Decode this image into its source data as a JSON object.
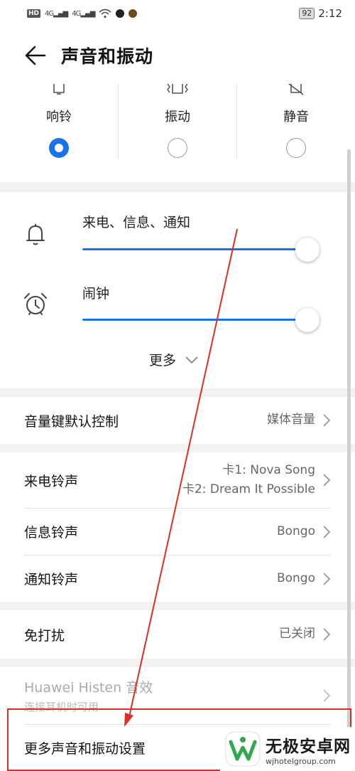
{
  "status_bar": {
    "left_chips": [
      "HD",
      "4G",
      "4G"
    ],
    "battery": "92",
    "time": "2:12"
  },
  "header": {
    "title": "声音和振动",
    "back_icon": "arrow-left-icon"
  },
  "sound_modes": [
    {
      "label": "响铃",
      "icon": "bell-icon",
      "selected": true
    },
    {
      "label": "振动",
      "icon": "vibrate-icon",
      "selected": false
    },
    {
      "label": "静音",
      "icon": "bell-off-icon",
      "selected": false
    }
  ],
  "volumes": [
    {
      "label": "来电、信息、通知",
      "icon": "bell-icon",
      "level": 1.0
    },
    {
      "label": "闹钟",
      "icon": "alarm-clock-icon",
      "level": 1.0
    }
  ],
  "more_label": "更多",
  "settings": {
    "volume_key": {
      "title": "音量键默认控制",
      "value": "媒体音量"
    },
    "ringtone": {
      "title": "来电铃声",
      "value_1": "卡1: Nova Song",
      "value_2": "卡2: Dream It Possible"
    },
    "message_tone": {
      "title": "信息铃声",
      "value": "Bongo"
    },
    "notification_tone": {
      "title": "通知铃声",
      "value": "Bongo"
    },
    "dnd": {
      "title": "免打扰",
      "value": "已关闭"
    },
    "histen": {
      "title": "Huawei Histen 音效",
      "subtitle": "连接耳机时可用"
    },
    "more_settings": {
      "title": "更多声音和振动设置"
    }
  },
  "watermark": {
    "name": "无极安卓网",
    "url": "wjhotelgroup.com"
  },
  "colors": {
    "accent": "#1a73e8",
    "annotation": "#d93025"
  }
}
